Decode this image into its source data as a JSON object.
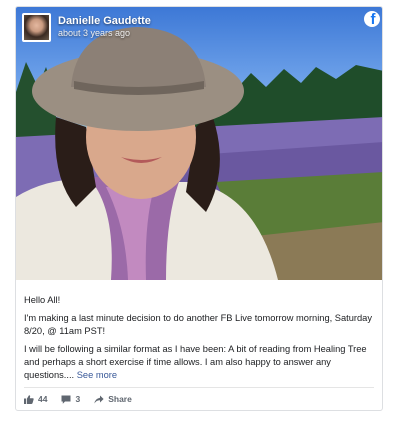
{
  "post": {
    "author": "Danielle Gaudette",
    "timestamp": "about 3 years ago",
    "greeting": "Hello All!",
    "paragraph1": "I'm making a last minute decision to do another FB Live tomorrow morning, Saturday 8/20, @ 11am PST!",
    "paragraph2": "I will be following a similar format as I have been: A bit of reading from Healing Tree and perhaps a short exercise if time allows. I am also happy to answer any questions....",
    "see_more": "See more"
  },
  "footer": {
    "likes": "44",
    "comments": "3",
    "share_label": "Share"
  },
  "icons": {
    "platform": "facebook-icon",
    "like": "thumbs-up-icon",
    "comment": "comment-icon",
    "share": "share-arrow-icon"
  },
  "colors": {
    "link": "#385898",
    "facebook_blue": "#1877f2",
    "meta_text": "#606770"
  }
}
